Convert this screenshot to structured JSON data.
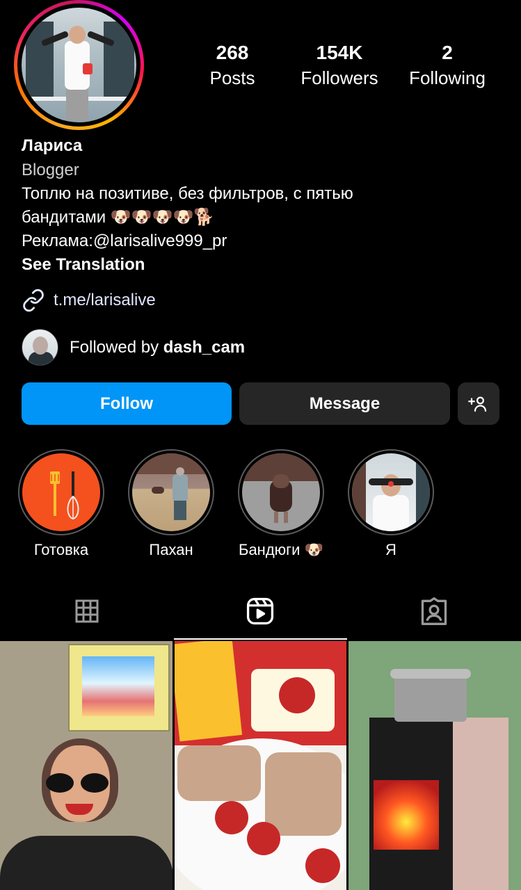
{
  "profile": {
    "display_name": "Лариса",
    "category": "Blogger",
    "bio_line1": "Топлю на позитиве, без фильтров, с пятью",
    "bio_line2": "бандитами 🐶🐶🐶🐶🐕",
    "bio_line3": "Реклама:@larisalive999_pr",
    "see_translation": "See Translation",
    "link": "t.me/larisalive"
  },
  "stats": {
    "posts_count": "268",
    "posts_label": "Posts",
    "followers_count": "154K",
    "followers_label": "Followers",
    "following_count": "2",
    "following_label": "Following"
  },
  "followed_by": {
    "prefix": "Followed by ",
    "username": "dash_cam"
  },
  "actions": {
    "follow_label": "Follow",
    "message_label": "Message",
    "add_user_icon": "person-plus-icon"
  },
  "highlights": [
    {
      "label": "Готовка"
    },
    {
      "label": "Пахан"
    },
    {
      "label": "Бандюги 🐶"
    },
    {
      "label": "Я"
    }
  ],
  "tabs": [
    {
      "icon": "grid-icon",
      "active": false
    },
    {
      "icon": "reels-icon",
      "active": true
    },
    {
      "icon": "tagged-icon",
      "active": false
    }
  ],
  "colors": {
    "follow_button": "#0095f6",
    "secondary_button": "#262626",
    "background": "#000000"
  }
}
